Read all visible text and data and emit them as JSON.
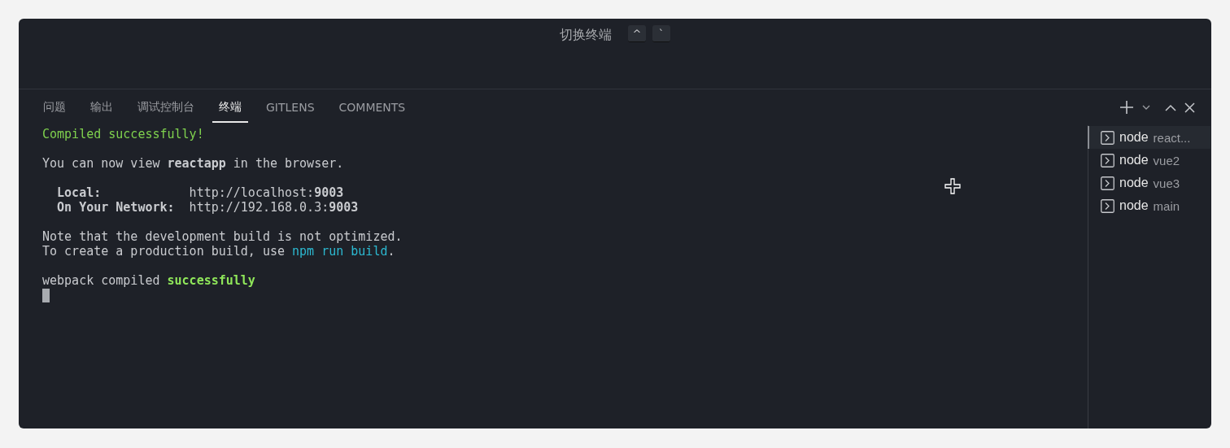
{
  "title_bar": {
    "title": "切换终端",
    "keys": [
      "^",
      "`"
    ]
  },
  "tabs": [
    {
      "label": "问题",
      "selected": false
    },
    {
      "label": "输出",
      "selected": false
    },
    {
      "label": "调试控制台",
      "selected": false
    },
    {
      "label": "终端",
      "selected": true
    },
    {
      "label": "GITLENS",
      "selected": false
    },
    {
      "label": "COMMENTS",
      "selected": false
    }
  ],
  "terminal": {
    "blocks": [
      [
        {
          "segments": [
            {
              "text": "Compiled successfully!",
              "kind": "green"
            }
          ]
        }
      ],
      [
        {
          "segments": [
            {
              "text": "You can now view ",
              "kind": "plain"
            },
            {
              "text": "reactapp",
              "kind": "bold"
            },
            {
              "text": " in the browser.",
              "kind": "plain"
            }
          ]
        }
      ],
      [
        {
          "segments": [
            {
              "text": "  Local:",
              "kind": "bold"
            },
            {
              "text": "            http://localhost:",
              "kind": "plain"
            },
            {
              "text": "9003",
              "kind": "bold"
            }
          ]
        },
        {
          "segments": [
            {
              "text": "  On Your Network:",
              "kind": "bold"
            },
            {
              "text": "  http://192.168.0.3:",
              "kind": "plain"
            },
            {
              "text": "9003",
              "kind": "bold"
            }
          ]
        }
      ],
      [
        {
          "segments": [
            {
              "text": "Note that the development build is not optimized.",
              "kind": "plain"
            }
          ]
        },
        {
          "segments": [
            {
              "text": "To create a production build, use ",
              "kind": "plain"
            },
            {
              "text": "npm run build",
              "kind": "cyan"
            },
            {
              "text": ".",
              "kind": "plain"
            }
          ]
        }
      ],
      [
        {
          "segments": [
            {
              "text": "webpack compiled ",
              "kind": "plain"
            },
            {
              "text": "successfully",
              "kind": "green-bold"
            }
          ]
        }
      ]
    ],
    "cursor": true
  },
  "terminals": [
    {
      "name": "node",
      "detail": "react...",
      "selected": true
    },
    {
      "name": "node",
      "detail": "vue2",
      "selected": false
    },
    {
      "name": "node",
      "detail": "vue3",
      "selected": false
    },
    {
      "name": "node",
      "detail": "main",
      "selected": false
    }
  ]
}
